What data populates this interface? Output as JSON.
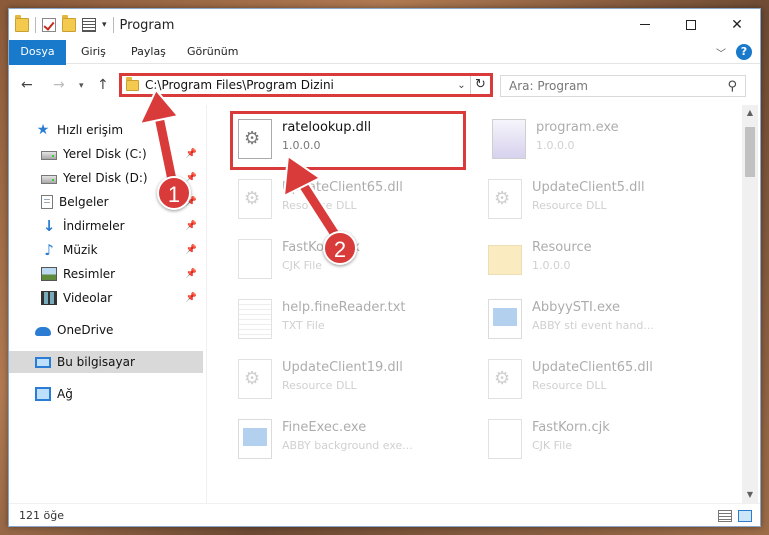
{
  "window": {
    "title": "Program",
    "minimize": "",
    "maximize": "",
    "close": "✕"
  },
  "ribbon": {
    "tabs": [
      "Dosya",
      "Giriş",
      "Paylaş",
      "Görünüm"
    ],
    "help": "?"
  },
  "nav": {
    "address": "C:\\Program Files\\Program Dizini",
    "search_placeholder": "Ara: Program"
  },
  "sidebar": {
    "quick_access": "Hızlı erişim",
    "items": [
      {
        "label": "Yerel Disk (C:)",
        "icon": "drive-icon"
      },
      {
        "label": "Yerel Disk (D:)",
        "icon": "drive-icon"
      },
      {
        "label": "Belgeler",
        "icon": "documents-icon"
      },
      {
        "label": "İndirmeler",
        "icon": "downloads-icon"
      },
      {
        "label": "Müzik",
        "icon": "music-icon"
      },
      {
        "label": "Resimler",
        "icon": "pictures-icon"
      },
      {
        "label": "Videolar",
        "icon": "videos-icon"
      }
    ],
    "onedrive": "OneDrive",
    "this_pc": "Bu bilgisayar",
    "network": "Ağ"
  },
  "files": [
    {
      "name": "ratelookup.dll",
      "sub": "1.0.0.0"
    },
    {
      "name": "program.exe",
      "sub": "1.0.0.0"
    },
    {
      "name": "UpdateClient65.dll",
      "sub": "Resource DLL"
    },
    {
      "name": "UpdateClient5.dll",
      "sub": "Resource DLL"
    },
    {
      "name": "FastKorn.cjk",
      "sub": "CJK File"
    },
    {
      "name": "Resource",
      "sub": "1.0.0.0"
    },
    {
      "name": "help.fineReader.txt",
      "sub": "TXT File"
    },
    {
      "name": "AbbyySTI.exe",
      "sub": "ABBY sti event hand..."
    },
    {
      "name": "UpdateClient19.dll",
      "sub": "Resource DLL"
    },
    {
      "name": "UpdateClient65.dll",
      "sub": "Resource DLL"
    },
    {
      "name": "FineExec.exe",
      "sub": "ABBY background exe..."
    },
    {
      "name": "FastKorn.cjk",
      "sub": "CJK File"
    }
  ],
  "status": {
    "count": "121 öğe"
  },
  "annotations": {
    "step1": "1",
    "step2": "2"
  },
  "colors": {
    "accent": "#1979ca",
    "highlight": "#d93a3a"
  }
}
